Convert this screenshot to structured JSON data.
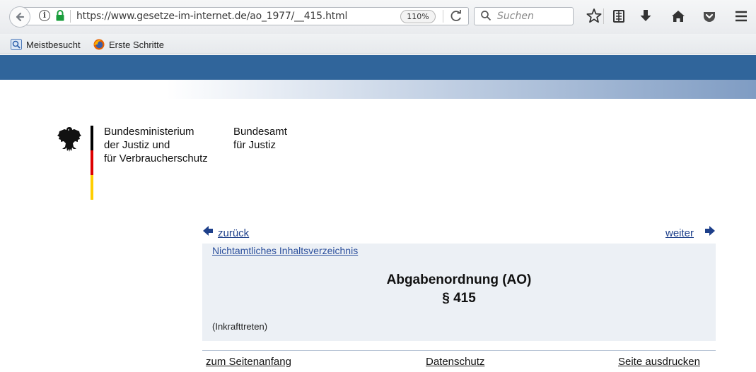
{
  "browser": {
    "url": "https://www.gesetze-im-internet.de/ao_1977/__415.html",
    "zoom": "110%",
    "search_placeholder": "Suchen",
    "bookmarks": [
      {
        "label": "Meistbesucht",
        "icon": "most-visited-icon"
      },
      {
        "label": "Erste Schritte",
        "icon": "firefox-icon"
      }
    ],
    "toolbar_icons": [
      "bookmark-star-icon",
      "reader-list-icon",
      "download-icon",
      "home-icon",
      "pocket-icon",
      "menu-icon"
    ]
  },
  "header": {
    "ministry": [
      "Bundesministerium",
      "der Justiz und",
      "für Verbraucherschutz"
    ],
    "office": [
      "Bundesamt",
      "für Justiz"
    ],
    "flag_colors": [
      "#000000",
      "#dd0000",
      "#ffce00"
    ]
  },
  "nav": {
    "back_label": "zurück",
    "forward_label": "weiter"
  },
  "content": {
    "toc_link": "Nichtamtliches Inhaltsverzeichnis",
    "law_title": "Abgabenordnung (AO)",
    "section": "§ 415",
    "note": "(Inkrafttreten)"
  },
  "footer": {
    "top_link": "zum Seitenanfang",
    "privacy_link": "Datenschutz",
    "print_link": "Seite ausdrucken"
  },
  "colors": {
    "header_band": "#30659b",
    "link": "#1d3f8a",
    "content_bg": "#ecf0f5"
  }
}
